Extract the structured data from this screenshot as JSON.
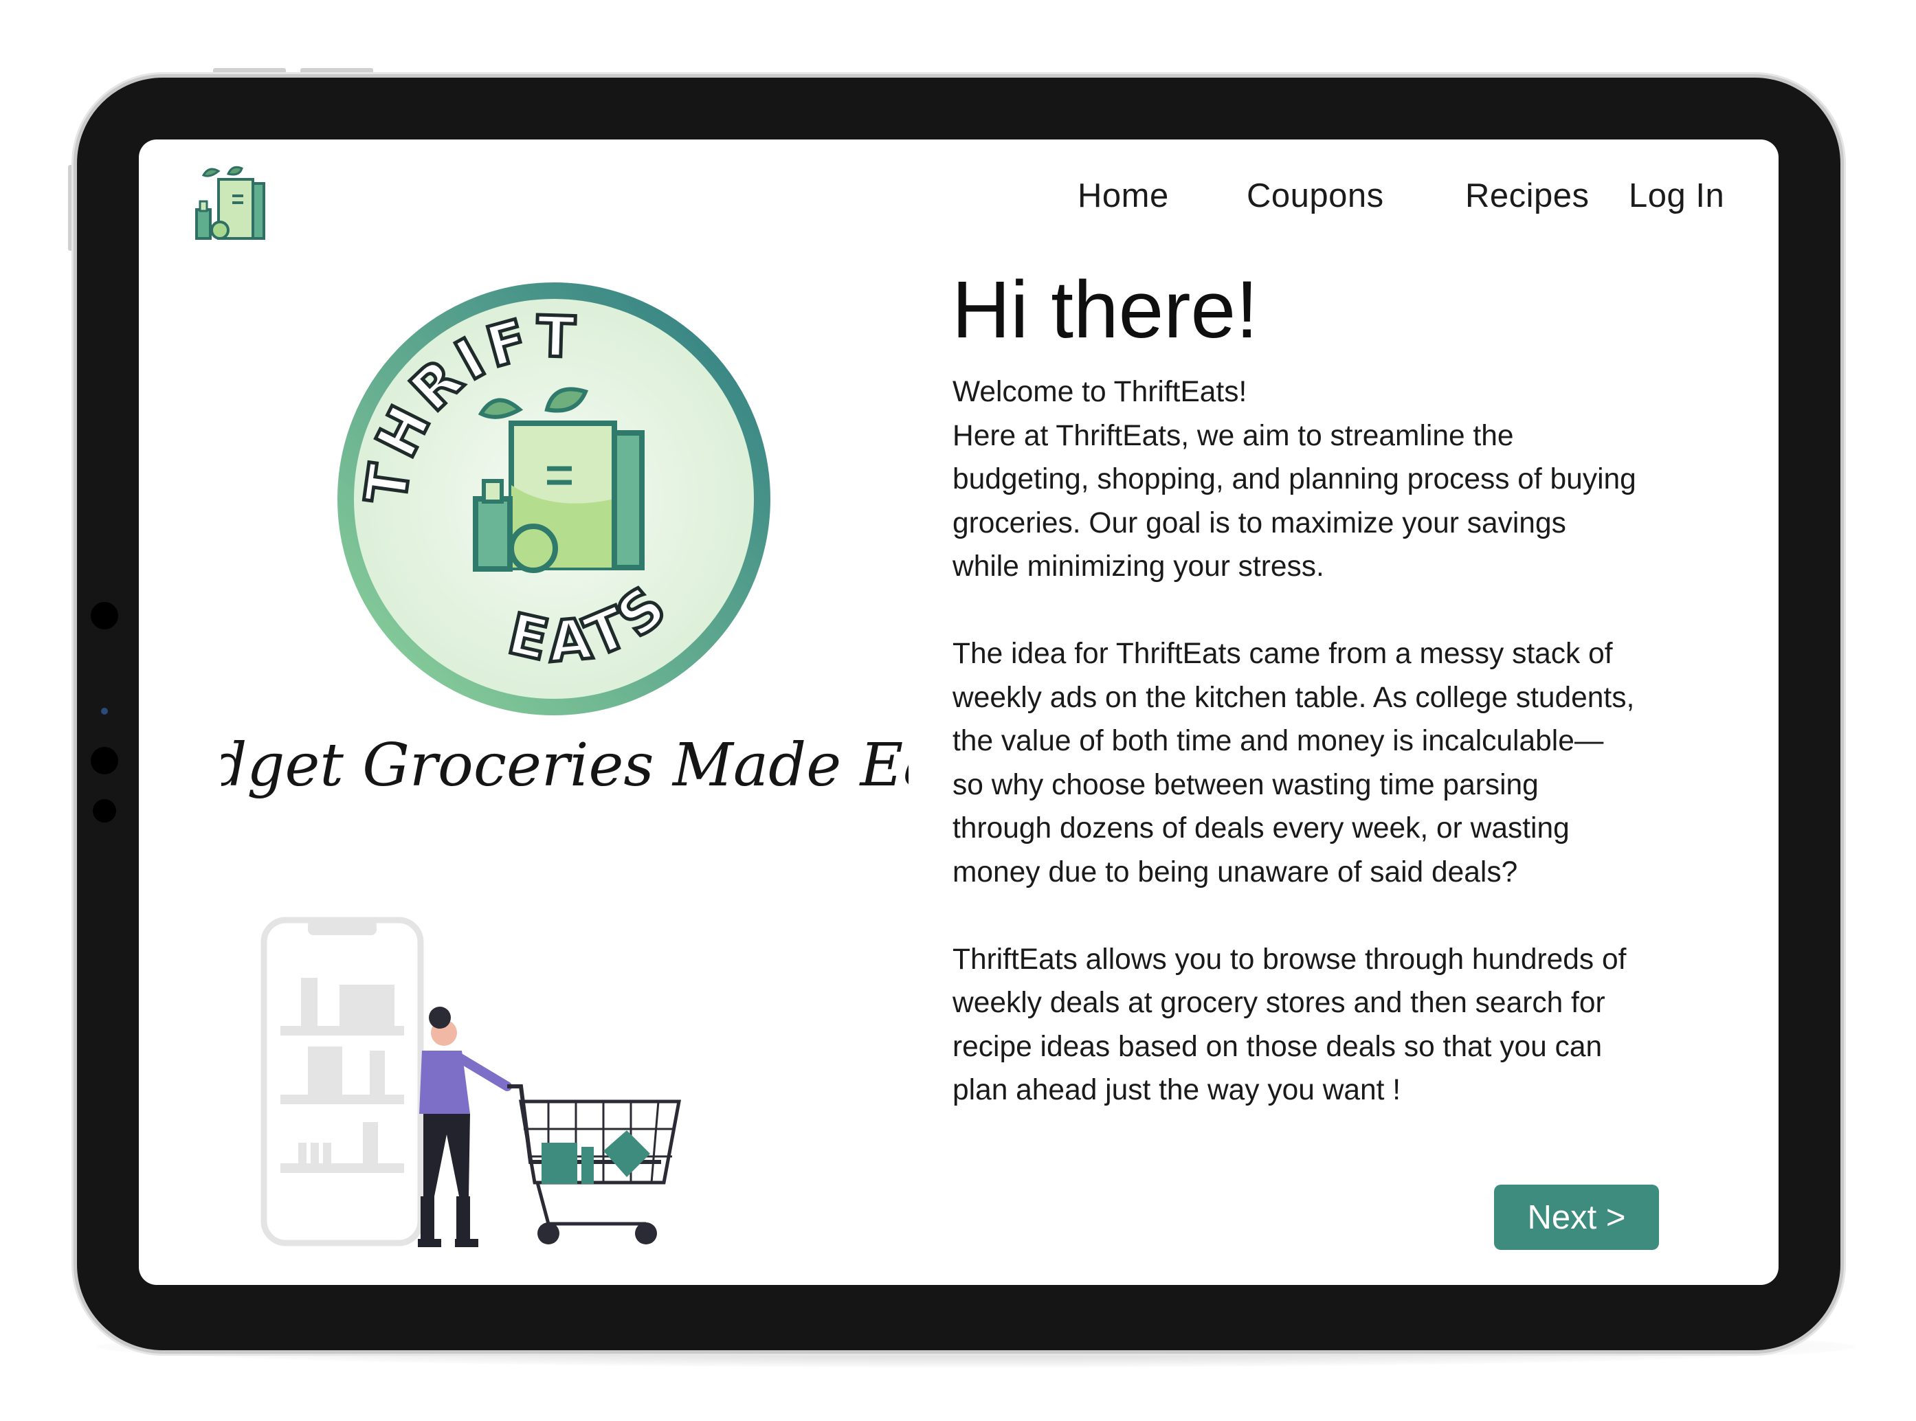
{
  "nav": {
    "links": [
      {
        "label": "Home"
      },
      {
        "label": "Coupons"
      },
      {
        "label": "Recipes"
      },
      {
        "label": "Log In"
      }
    ]
  },
  "brand": {
    "badge_text_top": "THRIFT",
    "badge_text_bottom": "EATS",
    "tagline": "Budget Groceries Made Easy"
  },
  "main": {
    "heading": "Hi there!",
    "paragraphs": [
      "Welcome to ThriftEats!\nHere at ThriftEats, we aim to streamline the budgeting, shopping, and planning process of buying groceries. Our goal is to maximize your savings while minimizing your stress.",
      "The idea for ThriftEats came from a messy stack of weekly ads on the kitchen table. As college students, the value of both time and money is incalculable— so why choose between wasting time parsing through dozens of deals every week, or wasting money due to being unaware of said deals?",
      "ThriftEats allows you to browse through hundreds of weekly deals at grocery stores and then search for recipe ideas based on those deals so that you can plan ahead just the way you want !"
    ],
    "next_label": "Next >"
  },
  "colors": {
    "accent": "#3d8c7e",
    "brand_green": "#3f8f7d",
    "light_green": "#c9e5b4",
    "bezel": "#151515"
  }
}
